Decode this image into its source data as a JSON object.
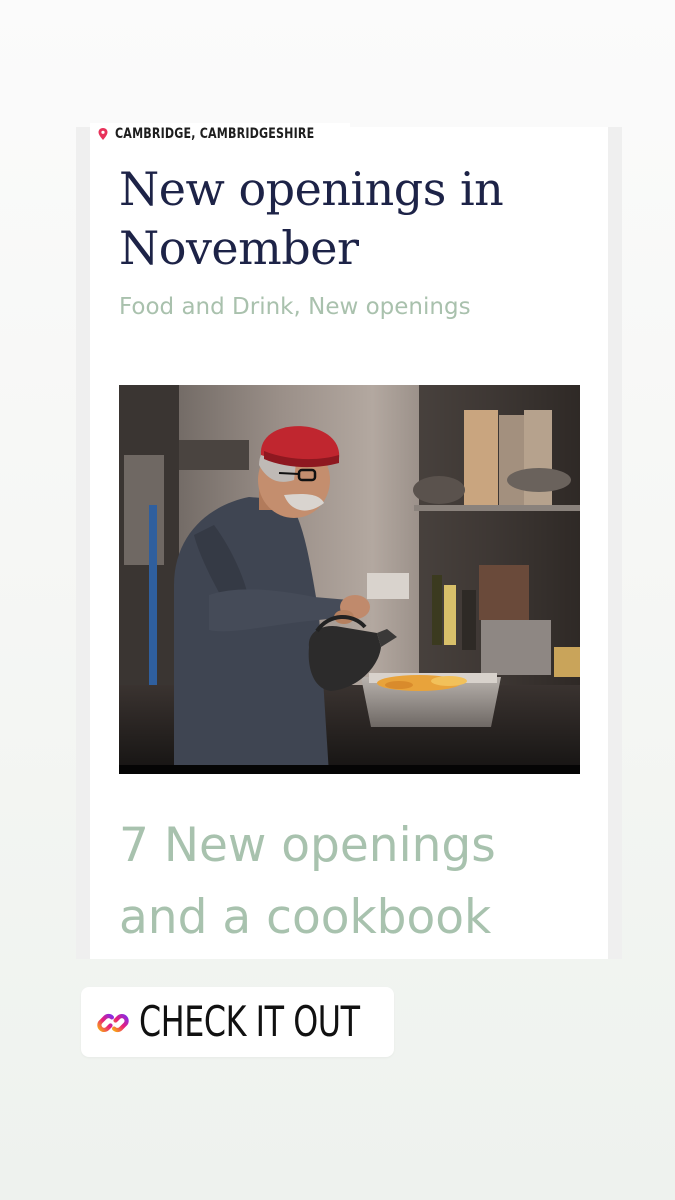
{
  "story": {
    "location": "CAMBRIDGE, CAMBRIDGESHIRE",
    "card": {
      "headline": "New openings in November",
      "categories": "Food and Drink, New openings",
      "photo": {
        "subject": "chef in red cap pouring from a kettle in a kitchen"
      },
      "subheadline_line1": "7 New openings",
      "subheadline_line2": "and a cookbook"
    },
    "link_sticker": {
      "label": "CHECK IT OUT",
      "icon": "link-icon"
    }
  },
  "colors": {
    "headline": "#1d2347",
    "accent_green": "#a8c2ae",
    "pin": "#e8325a",
    "link_gradient_start": "#f7a11a",
    "link_gradient_mid": "#e91e7a",
    "link_gradient_end": "#8a2be2"
  }
}
